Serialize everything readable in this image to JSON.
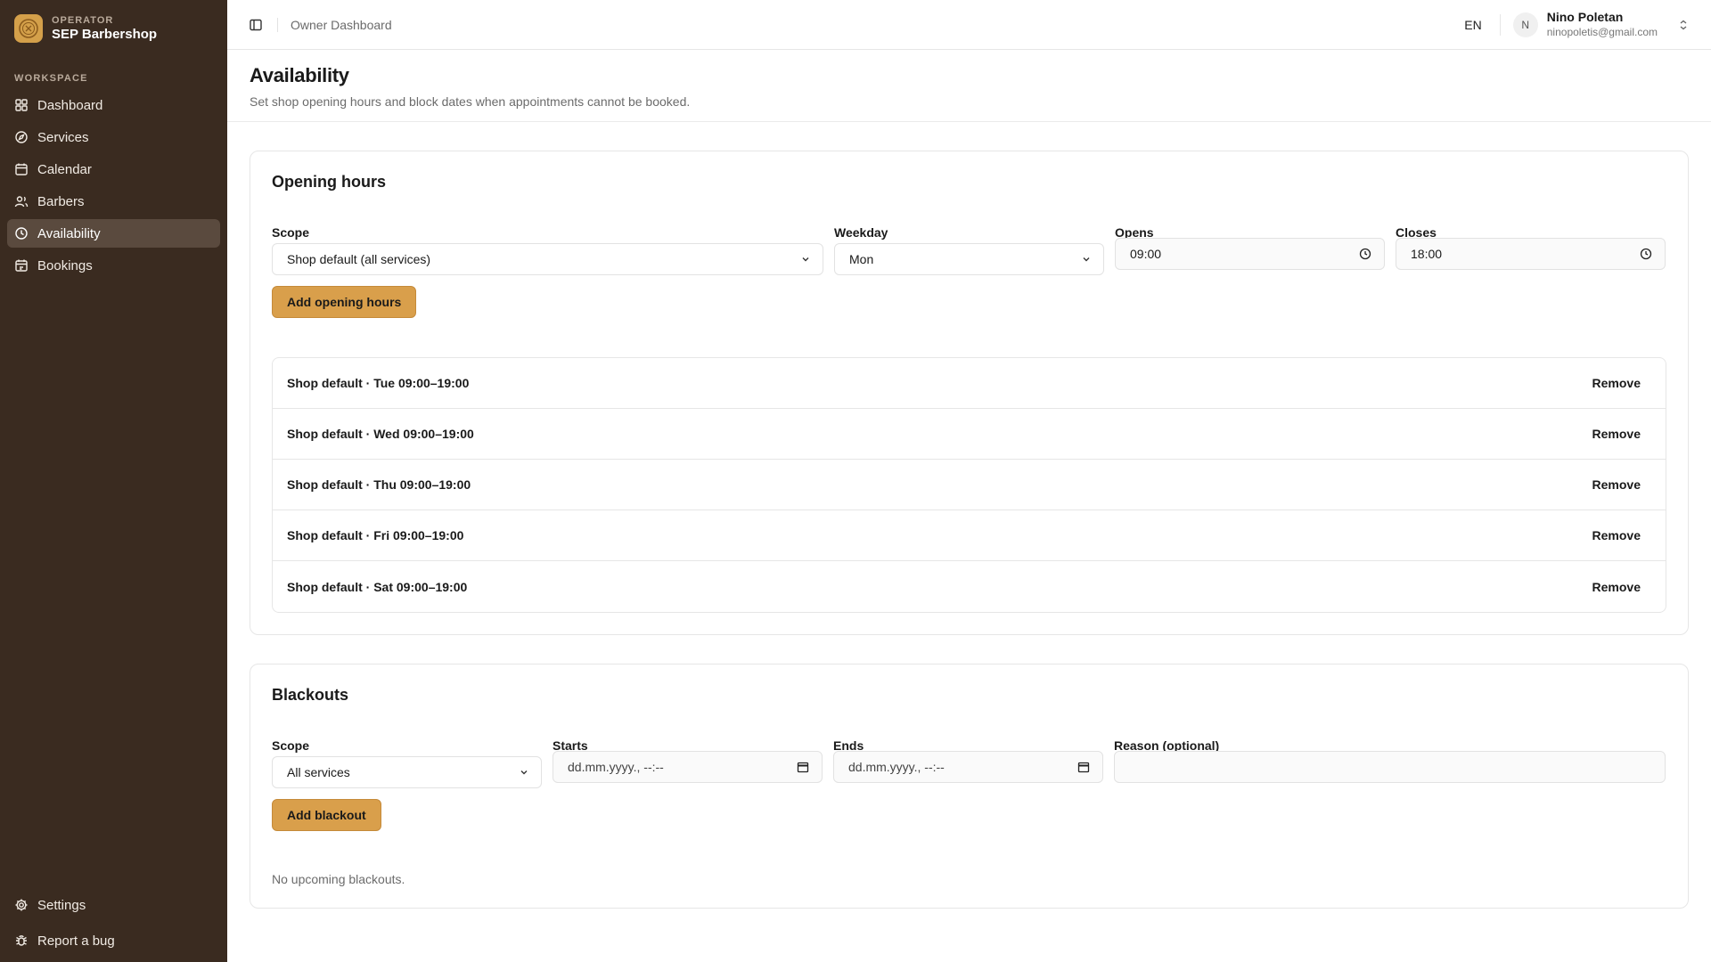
{
  "brand": {
    "overline": "OPERATOR",
    "name": "SEP Barbershop"
  },
  "sidebar": {
    "section_label": "WORKSPACE",
    "items": [
      {
        "label": "Dashboard",
        "icon": "grid-icon"
      },
      {
        "label": "Services",
        "icon": "compass-icon"
      },
      {
        "label": "Calendar",
        "icon": "calendar-icon"
      },
      {
        "label": "Barbers",
        "icon": "users-icon"
      },
      {
        "label": "Availability",
        "icon": "clock-icon",
        "active": true
      },
      {
        "label": "Bookings",
        "icon": "calendar-check-icon"
      }
    ],
    "footer": [
      {
        "label": "Settings",
        "icon": "gear-icon"
      },
      {
        "label": "Report a bug",
        "icon": "bug-icon"
      }
    ]
  },
  "topbar": {
    "breadcrumb": "Owner Dashboard",
    "lang": "EN",
    "user": {
      "initial": "N",
      "name": "Nino Poletan",
      "email": "ninopoletis@gmail.com"
    }
  },
  "page": {
    "title": "Availability",
    "subtitle": "Set shop opening hours and block dates when appointments cannot be booked."
  },
  "opening_hours": {
    "title": "Opening hours",
    "scope_label": "Scope",
    "scope_value": "Shop default (all services)",
    "weekday_label": "Weekday",
    "weekday_value": "Mon",
    "opens_label": "Opens",
    "opens_value": "09:00",
    "closes_label": "Closes",
    "closes_value": "18:00",
    "add_label": "Add opening hours",
    "remove_label": "Remove",
    "rows": [
      "Shop default · Tue 09:00–19:00",
      "Shop default · Wed 09:00–19:00",
      "Shop default · Thu 09:00–19:00",
      "Shop default · Fri 09:00–19:00",
      "Shop default · Sat 09:00–19:00"
    ]
  },
  "blackouts": {
    "title": "Blackouts",
    "scope_label": "Scope",
    "scope_value": "All services",
    "starts_label": "Starts",
    "starts_placeholder": "dd.mm.yyyy., --:--",
    "ends_label": "Ends",
    "ends_placeholder": "dd.mm.yyyy., --:--",
    "reason_label": "Reason (optional)",
    "reason_value": "",
    "add_label": "Add blackout",
    "empty_message": "No upcoming blackouts."
  },
  "colors": {
    "sidebar_bg": "#3a2b20",
    "sidebar_active": "#5a4a3e",
    "accent": "#d99f4b"
  }
}
